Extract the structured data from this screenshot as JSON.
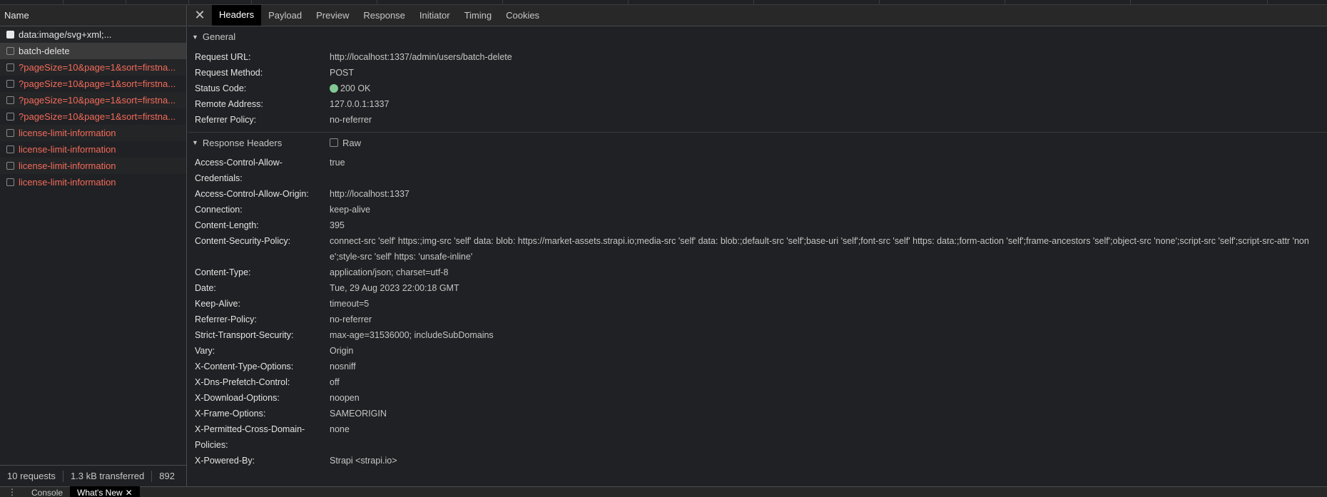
{
  "list": {
    "header": "Name",
    "requests": [
      {
        "name": "data:image/svg+xml;...",
        "state": "ok",
        "icon": "image-icon"
      },
      {
        "name": "batch-delete",
        "state": "ok",
        "icon": "document-icon"
      },
      {
        "name": "?pageSize=10&page=1&sort=firstna...",
        "state": "err",
        "icon": "document-icon"
      },
      {
        "name": "?pageSize=10&page=1&sort=firstna...",
        "state": "err",
        "icon": "document-icon"
      },
      {
        "name": "?pageSize=10&page=1&sort=firstna...",
        "state": "err",
        "icon": "document-icon"
      },
      {
        "name": "?pageSize=10&page=1&sort=firstna...",
        "state": "err",
        "icon": "document-icon"
      },
      {
        "name": "license-limit-information",
        "state": "err",
        "icon": "document-icon"
      },
      {
        "name": "license-limit-information",
        "state": "err",
        "icon": "document-icon"
      },
      {
        "name": "license-limit-information",
        "state": "err",
        "icon": "document-icon"
      },
      {
        "name": "license-limit-information",
        "state": "err",
        "icon": "document-icon"
      }
    ],
    "status": {
      "requests": "10 requests",
      "transferred": "1.3 kB transferred",
      "resources": "892"
    }
  },
  "tabs": {
    "close": "✕",
    "items": [
      "Headers",
      "Payload",
      "Preview",
      "Response",
      "Initiator",
      "Timing",
      "Cookies"
    ],
    "active": "Headers"
  },
  "general": {
    "title": "General",
    "rows": [
      {
        "key": "Request URL:",
        "value": "http://localhost:1337/admin/users/batch-delete"
      },
      {
        "key": "Request Method:",
        "value": "POST"
      },
      {
        "key": "Status Code:",
        "value": "200 OK"
      },
      {
        "key": "Remote Address:",
        "value": "127.0.0.1:1337"
      },
      {
        "key": "Referrer Policy:",
        "value": "no-referrer"
      }
    ]
  },
  "response_headers": {
    "title": "Response Headers",
    "raw_label": "Raw",
    "rows": [
      {
        "key": "Access-Control-Allow-Credentials:",
        "value": "true"
      },
      {
        "key": "Access-Control-Allow-Origin:",
        "value": "http://localhost:1337"
      },
      {
        "key": "Connection:",
        "value": "keep-alive"
      },
      {
        "key": "Content-Length:",
        "value": "395"
      },
      {
        "key": "Content-Security-Policy:",
        "value": "connect-src 'self' https:;img-src 'self' data: blob: https://market-assets.strapi.io;media-src 'self' data: blob:;default-src 'self';base-uri 'self';font-src 'self' https: data:;form-action 'self';frame-ancestors 'self';object-src 'none';script-src 'self';script-src-attr 'none';style-src 'self' https: 'unsafe-inline'"
      },
      {
        "key": "Content-Type:",
        "value": "application/json; charset=utf-8"
      },
      {
        "key": "Date:",
        "value": "Tue, 29 Aug 2023 22:00:18 GMT"
      },
      {
        "key": "Keep-Alive:",
        "value": "timeout=5"
      },
      {
        "key": "Referrer-Policy:",
        "value": "no-referrer"
      },
      {
        "key": "Strict-Transport-Security:",
        "value": "max-age=31536000; includeSubDomains"
      },
      {
        "key": "Vary:",
        "value": "Origin"
      },
      {
        "key": "X-Content-Type-Options:",
        "value": "nosniff"
      },
      {
        "key": "X-Dns-Prefetch-Control:",
        "value": "off"
      },
      {
        "key": "X-Download-Options:",
        "value": "noopen"
      },
      {
        "key": "X-Frame-Options:",
        "value": "SAMEORIGIN"
      },
      {
        "key": "X-Permitted-Cross-Domain-Policies:",
        "value": "none"
      },
      {
        "key": "X-Powered-By:",
        "value": "Strapi <strapi.io>"
      }
    ]
  },
  "drawer": {
    "menu": "⋮",
    "tabs": [
      "Console",
      "What's New"
    ],
    "active": "What's New",
    "close": "✕"
  },
  "colors": {
    "error_text": "#f36b5a",
    "status_ok": "#81c995",
    "active_tab_bg": "#000000"
  }
}
